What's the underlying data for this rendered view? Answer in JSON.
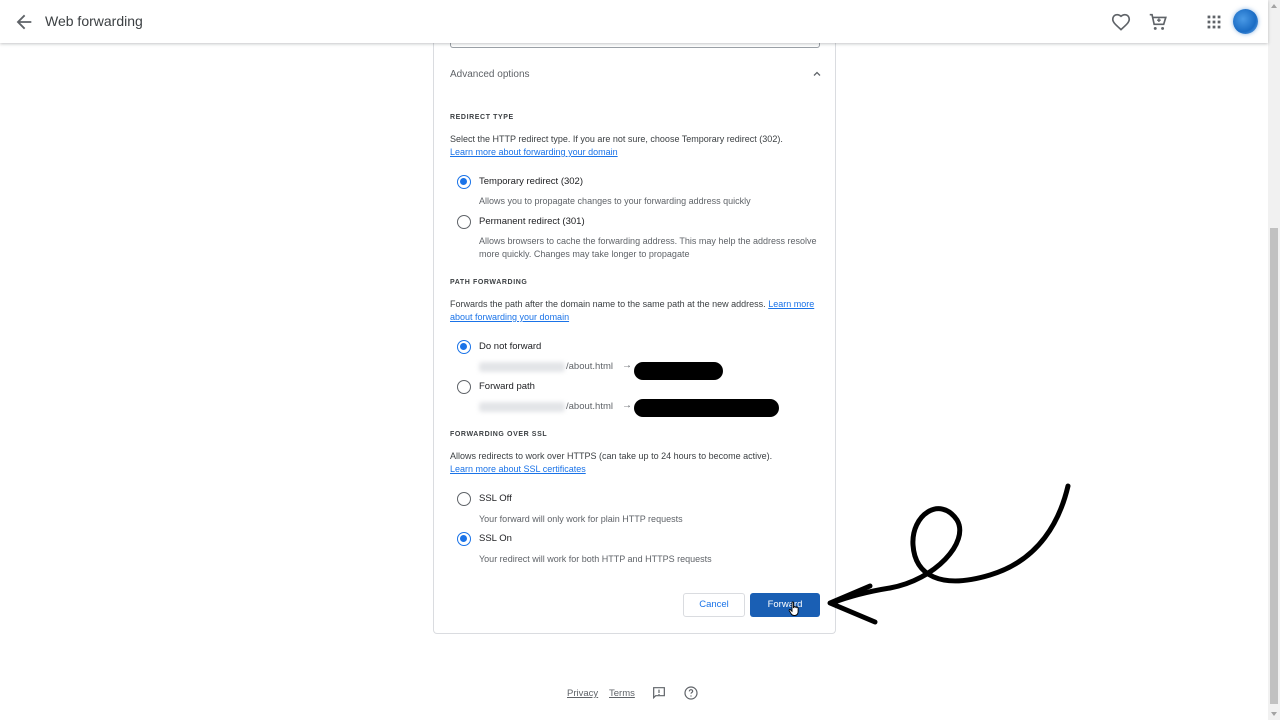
{
  "header": {
    "title": "Web forwarding",
    "icons": [
      "arrow-back-icon",
      "heart-icon",
      "cart-icon",
      "apps-grid-icon",
      "account-avatar"
    ]
  },
  "advanced": {
    "label": "Advanced options"
  },
  "redirect_type": {
    "heading": "REDIRECT TYPE",
    "description": "Select the HTTP redirect type. If you are not sure, choose Temporary redirect (302).",
    "link": "Learn more about forwarding your domain",
    "options": [
      {
        "label": "Temporary redirect (302)",
        "help": "Allows you to propagate changes to your forwarding address quickly",
        "selected": true
      },
      {
        "label": "Permanent redirect (301)",
        "help": "Allows browsers to cache the forwarding address. This may help the address resolve more quickly. Changes may take longer to propagate",
        "selected": false
      }
    ]
  },
  "path_forwarding": {
    "heading": "PATH FORWARDING",
    "description": "Forwards the path after the domain name to the same path at the new address.",
    "link": "Learn more about forwarding your domain",
    "options": [
      {
        "label": "Do not forward",
        "path": "/about.html",
        "selected": true
      },
      {
        "label": "Forward path",
        "path": "/about.html",
        "selected": false
      }
    ]
  },
  "ssl": {
    "heading": "FORWARDING OVER SSL",
    "description": "Allows redirects to work over HTTPS (can take up to 24 hours to become active).",
    "link": "Learn more about SSL certificates",
    "options": [
      {
        "label": "SSL Off",
        "help": "Your forward will only work for plain HTTP requests",
        "selected": false
      },
      {
        "label": "SSL On",
        "help": "Your redirect will work for both HTTP and HTTPS requests",
        "selected": true
      }
    ]
  },
  "actions": {
    "cancel": "Cancel",
    "forward": "Forward"
  },
  "footer": {
    "privacy": "Privacy",
    "terms": "Terms",
    "icons": [
      "feedback-icon",
      "help-icon"
    ]
  },
  "colors": {
    "primary": "#1a73e8",
    "primary_button": "#1a5fb4",
    "border": "#dadce0"
  }
}
